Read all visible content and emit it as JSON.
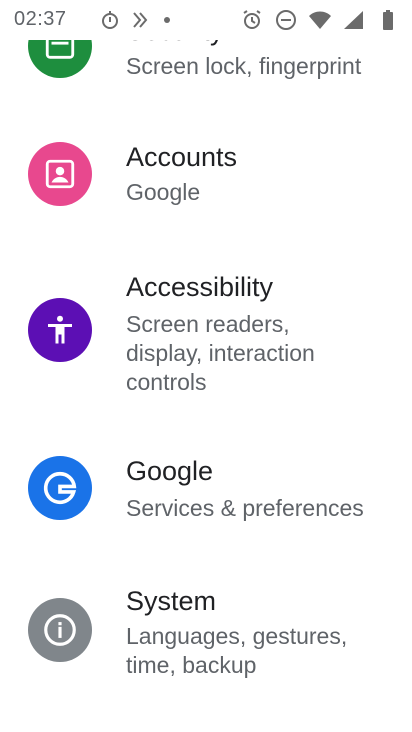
{
  "status_bar": {
    "time": "02:37",
    "icons": [
      "stopwatch-icon",
      "missed-call-icon",
      "notification-dot-icon",
      "alarm-icon",
      "do-not-disturb-icon",
      "wifi-icon",
      "signal-icon",
      "battery-icon"
    ]
  },
  "settings": {
    "items": [
      {
        "icon": "lock-icon",
        "color": "#1e8e3e",
        "title": "Security",
        "subtitle_lines": [
          "Screen lock, fingerprint"
        ]
      },
      {
        "icon": "account-box-icon",
        "color": "#e8488e",
        "title": "Accounts",
        "subtitle_lines": [
          "Google"
        ]
      },
      {
        "icon": "accessibility-icon",
        "color": "#5c0fb4",
        "title": "Accessibility",
        "subtitle_lines": [
          "Screen readers,",
          "display, interaction",
          "controls"
        ]
      },
      {
        "icon": "google-g-icon",
        "color": "#1a73e8",
        "title": "Google",
        "subtitle_lines": [
          "Services & preferences"
        ]
      },
      {
        "icon": "info-icon",
        "color": "#80868b",
        "title": "System",
        "subtitle_lines": [
          "Languages, gestures,",
          "time, backup"
        ]
      }
    ]
  }
}
